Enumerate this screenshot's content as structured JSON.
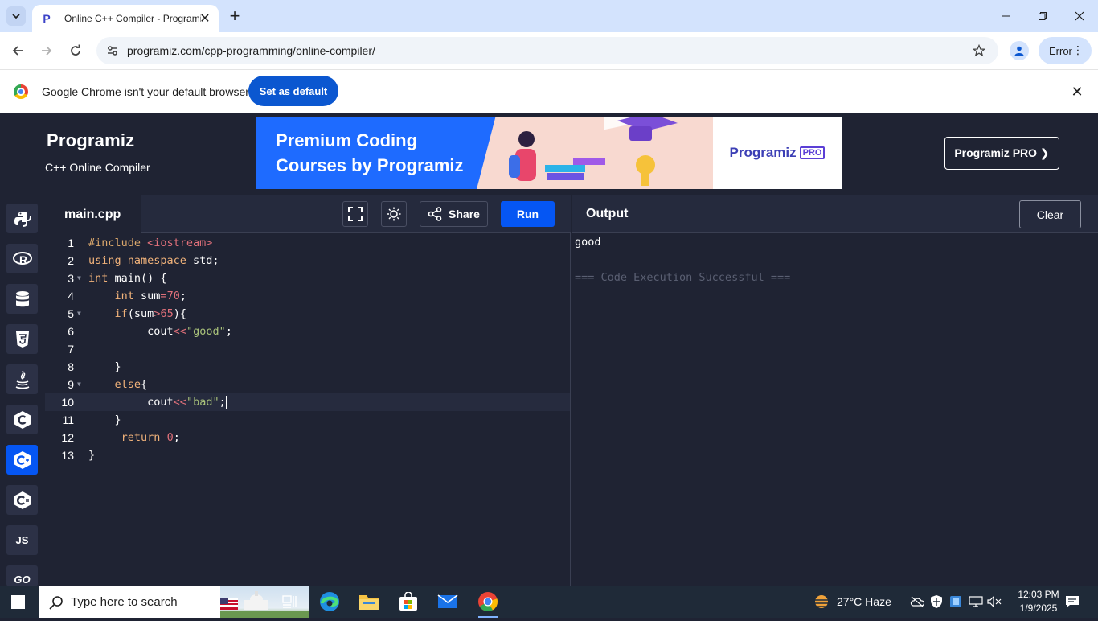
{
  "browser": {
    "tab_title": "Online C++ Compiler - Programiz",
    "url": "programiz.com/cpp-programming/online-compiler/",
    "profile_status": "Error"
  },
  "infobar": {
    "message": "Google Chrome isn't your default browser",
    "button": "Set as default"
  },
  "header": {
    "logo": "Programiz",
    "subtitle": "C++ Online Compiler",
    "banner_text": "Premium Coding Courses by Programiz",
    "banner_logo": "Programiz",
    "banner_logo_badge": "PRO",
    "pro_button": "Programiz PRO ❯"
  },
  "sidebar": {
    "languages": [
      {
        "name": "python-icon"
      },
      {
        "name": "r-icon"
      },
      {
        "name": "sql-icon"
      },
      {
        "name": "html-icon"
      },
      {
        "name": "java-icon"
      },
      {
        "name": "c-icon"
      },
      {
        "name": "cpp-icon",
        "active": true
      },
      {
        "name": "csharp-icon"
      },
      {
        "name": "js-icon",
        "label": "JS"
      },
      {
        "name": "go-icon",
        "label": "GO"
      }
    ]
  },
  "editor": {
    "filename": "main.cpp",
    "share_label": "Share",
    "run_label": "Run",
    "current_line": 10,
    "lines": [
      {
        "n": "1",
        "text": "#include <iostream>"
      },
      {
        "n": "2",
        "text": "using namespace std;"
      },
      {
        "n": "3",
        "text": "int main() {"
      },
      {
        "n": "4",
        "text": "    int sum=70;"
      },
      {
        "n": "5",
        "text": "    if(sum>65){"
      },
      {
        "n": "6",
        "text": "         cout<<\"good\";"
      },
      {
        "n": "7",
        "text": ""
      },
      {
        "n": "8",
        "text": "    }"
      },
      {
        "n": "9",
        "text": "    else{"
      },
      {
        "n": "10",
        "text": "         cout<<\"bad\";"
      },
      {
        "n": "11",
        "text": "    }"
      },
      {
        "n": "12",
        "text": "     return 0;"
      },
      {
        "n": "13",
        "text": "}"
      }
    ]
  },
  "output": {
    "title": "Output",
    "clear_label": "Clear",
    "result": "good",
    "status": "=== Code Execution Successful ==="
  },
  "taskbar": {
    "search_placeholder": "Type here to search",
    "weather": "27°C  Haze",
    "time": "12:03 PM",
    "date": "1/9/2025"
  },
  "colors": {
    "accent": "#0556f3",
    "background": "#1f2333",
    "chrome_blue": "#0b57d0"
  }
}
